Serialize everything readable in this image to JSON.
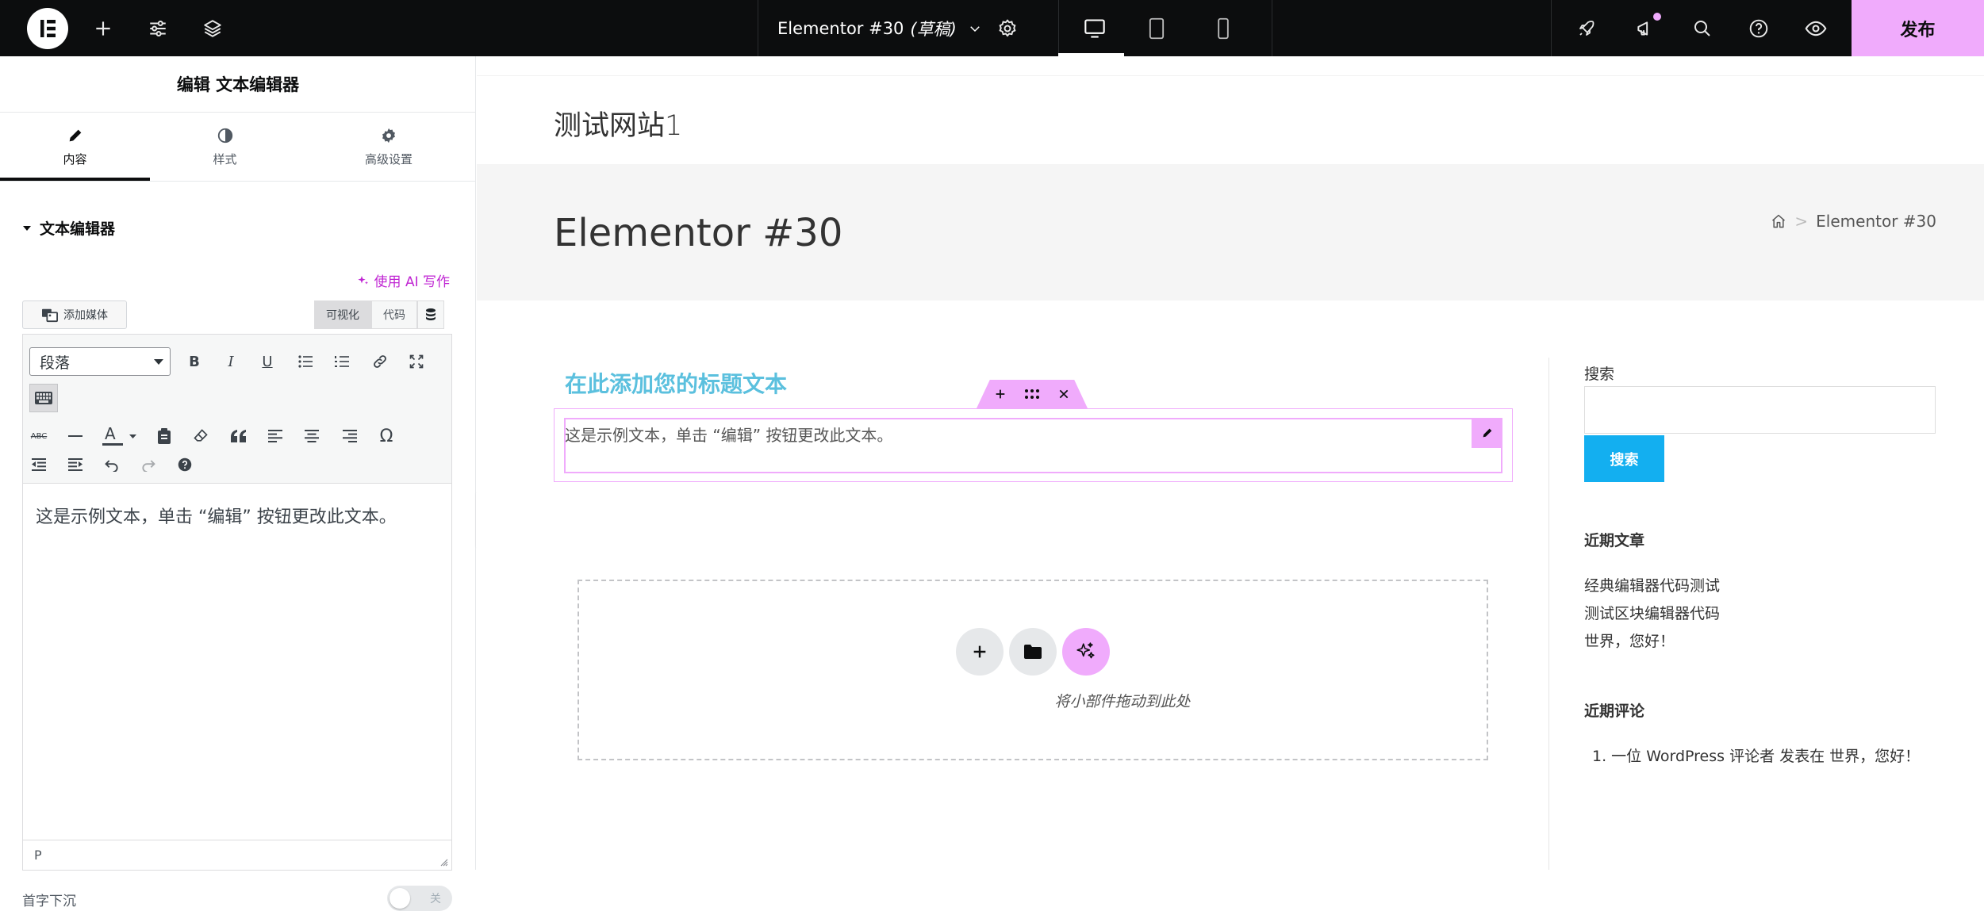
{
  "topbar": {
    "doc_title": "Elementor #30",
    "doc_status": "(草稿)",
    "publish_label": "发布"
  },
  "panel": {
    "title": "编辑 文本编辑器",
    "tabs": [
      {
        "label": "内容",
        "icon": "pencil-icon"
      },
      {
        "label": "样式",
        "icon": "half-circle-icon"
      },
      {
        "label": "高级设置",
        "icon": "gear-icon"
      }
    ],
    "section_title": "文本编辑器",
    "ai_link": "使用 AI 写作",
    "add_media": "添加媒体",
    "mode_visual": "可视化",
    "mode_code": "代码",
    "format_select": "段落",
    "editor_text": "这是示例文本，单击 “编辑” 按钮更改此文本。",
    "status_path": "P",
    "dropcap_label": "首字下沉",
    "dropcap_state": "关"
  },
  "preview": {
    "site_title": "测试网站1",
    "page_title": "Elementor #30",
    "breadcrumb": {
      "separator": ">",
      "current": "Elementor #30"
    },
    "heading_text": "在此添加您的标题文本",
    "widget_text": "这是示例文本，单击 “编辑” 按钮更改此文本。",
    "drop_zone_label": "将小部件拖动到此处"
  },
  "sidebar": {
    "search_label": "搜索",
    "search_button": "搜索",
    "recent_posts_title": "近期文章",
    "recent_posts": [
      "经典编辑器代码测试",
      "测试区块编辑器代码",
      "世界，您好！"
    ],
    "recent_comments_title": "近期评论",
    "recent_comment": "1. 一位 WordPress 评论者 发表在 世界，您好！"
  },
  "colors": {
    "accent": "#f0abfc",
    "topbar_bg": "#0c0d0e",
    "search_button": "#13aff0",
    "heading": "#5bc0de",
    "ai_link": "#c026d3"
  }
}
